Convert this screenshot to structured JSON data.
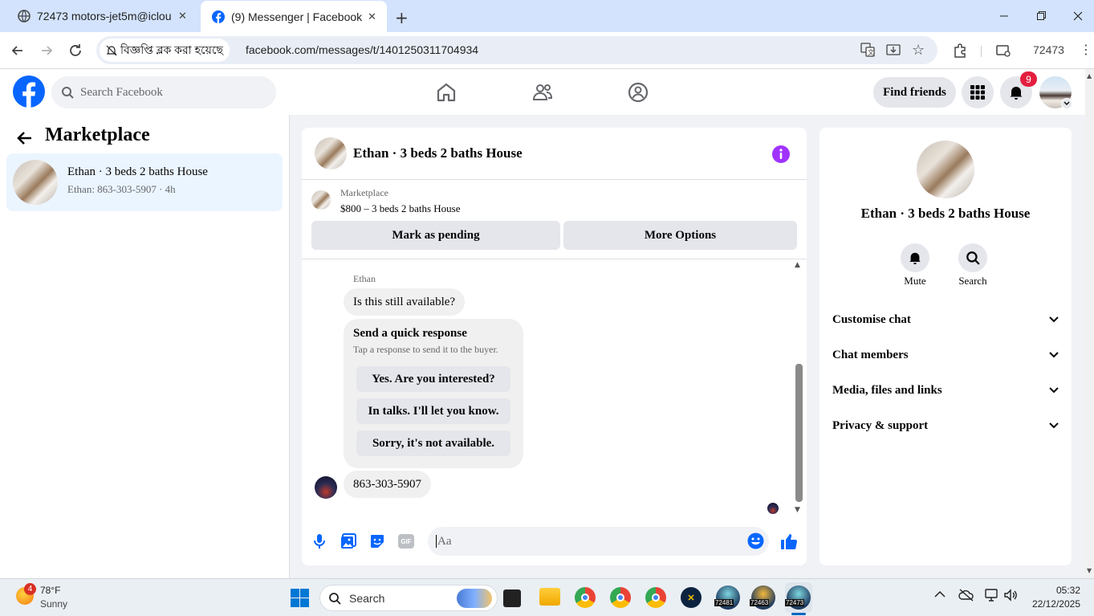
{
  "browser": {
    "tabs": [
      {
        "title": "72473 motors-jet5m@iclou",
        "icon": "globe-icon"
      },
      {
        "title": "(9) Messenger | Facebook",
        "icon": "facebook-icon"
      }
    ],
    "security_chip": "বিজ্ঞপ্তি ব্লক করা হয়েছে",
    "url": "facebook.com/messages/t/1401250311704934",
    "profile_label": "72473"
  },
  "fb_header": {
    "search_placeholder": "Search Facebook",
    "find_friends": "Find friends",
    "notification_count": "9"
  },
  "left_pane": {
    "title": "Marketplace",
    "conversations": [
      {
        "name": "Ethan · 3 beds 2 baths House",
        "preview": "Ethan: 863-303-5907 · 4h"
      }
    ]
  },
  "chat": {
    "title": "Ethan · 3 beds 2 baths House",
    "listing_source": "Marketplace",
    "listing_price_title": "$800 – 3 beds 2 baths House",
    "mark_pending": "Mark as pending",
    "more_options": "More Options",
    "sender_name": "Ethan",
    "first_message": "Is this still available?",
    "quick_response_title": "Send a quick response",
    "quick_response_sub": "Tap a response to send it to the buyer.",
    "quick_responses": [
      "Yes. Are you interested?",
      "In talks. I'll let you know.",
      "Sorry, it's not available."
    ],
    "reply_message": "863-303-5907",
    "composer_placeholder": "Aa"
  },
  "info_panel": {
    "title": "Ethan · 3 beds 2 baths House",
    "mute": "Mute",
    "search": "Search",
    "sections": [
      "Customise chat",
      "Chat members",
      "Media, files and links",
      "Privacy & support"
    ]
  },
  "taskbar": {
    "weather_badge": "4",
    "temp": "78°F",
    "condition": "Sunny",
    "search_label": "Search",
    "app_labels": [
      "72481",
      "72463",
      "72473"
    ],
    "time": "05:32",
    "date": "22/12/2025"
  },
  "colors": {
    "fb_blue": "#0866ff",
    "messenger_purple": "#a033ff",
    "selected_bg": "#ebf5ff",
    "notification_red": "#e41e3f"
  }
}
